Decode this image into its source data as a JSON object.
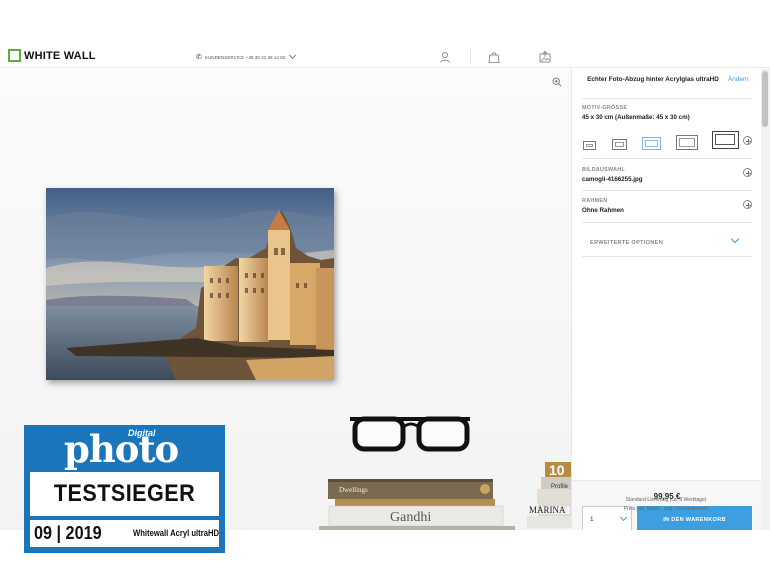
{
  "header": {
    "logo_text": "WHITE WALL",
    "service_text": "KUNDENSERVICE +49 30 22 38 14 62",
    "icons": [
      "phone-icon",
      "account-icon",
      "bag-icon",
      "upload-photo-icon"
    ]
  },
  "canvas": {
    "zoom_icon": "zoom-in-icon"
  },
  "panel": {
    "title": "Echter Foto-Abzug hinter Acrylglas ultraHD",
    "change_link": "Ändern",
    "size_label": "MOTIV-GRÖSSE",
    "size_value": "45 x 30 cm (Außenmaße: 45 x 30 cm)",
    "image_label": "BILDAUSWAHL",
    "image_value": "camogli-4166255.jpg",
    "frame_label": "RAHMEN",
    "frame_value": "Ohne Rahmen",
    "advanced_label": "ERWEITERTE OPTIONEN",
    "price": "99,95 €",
    "quantity": "1",
    "cart_button": "IN DEN WARENKORB",
    "shipping_line1": "Standard-Lieferung (ca. 8 Werktage)",
    "shipping_line2": "Preis inkl. MwSt., zzgl. Versandkosten"
  },
  "decor": {
    "book_titles": [
      "Dwellings",
      "Gandhi",
      "Profile",
      "MARINA",
      "10"
    ]
  },
  "badge": {
    "digital": "Digital",
    "photo": "photo",
    "testsieger": "TESTSIEGER",
    "date": "09 | 2019",
    "product": "Whitewall Acryl ultraHD"
  },
  "colors": {
    "accent": "#3d9fe0",
    "logo_green": "#5fae3c",
    "badge_blue": "#1b75bb"
  }
}
